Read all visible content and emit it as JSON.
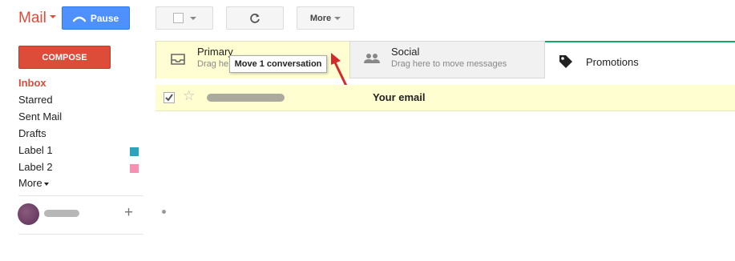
{
  "header": {
    "app_title": "Mail",
    "pause_label": "Pause",
    "more_label": "More"
  },
  "sidebar": {
    "compose_label": "COMPOSE",
    "items": [
      {
        "label": "Inbox"
      },
      {
        "label": "Starred"
      },
      {
        "label": "Sent Mail"
      },
      {
        "label": "Drafts"
      },
      {
        "label": "Label 1",
        "color": "#2da2bb"
      },
      {
        "label": "Label 2",
        "color": "#f691b2"
      },
      {
        "label": "More"
      }
    ]
  },
  "tabs": [
    {
      "title": "Primary",
      "subtitle": "Drag he"
    },
    {
      "title": "Social",
      "subtitle": "Drag here to move messages"
    },
    {
      "title": "Promotions"
    }
  ],
  "tooltip": {
    "text": "Move 1 conversation"
  },
  "message": {
    "subject": "Your email"
  },
  "colors": {
    "accent_red": "#dd4b39",
    "pause_blue": "#4d90fe",
    "arrow_red": "#d42a2a",
    "promotions_green": "#16a765"
  }
}
